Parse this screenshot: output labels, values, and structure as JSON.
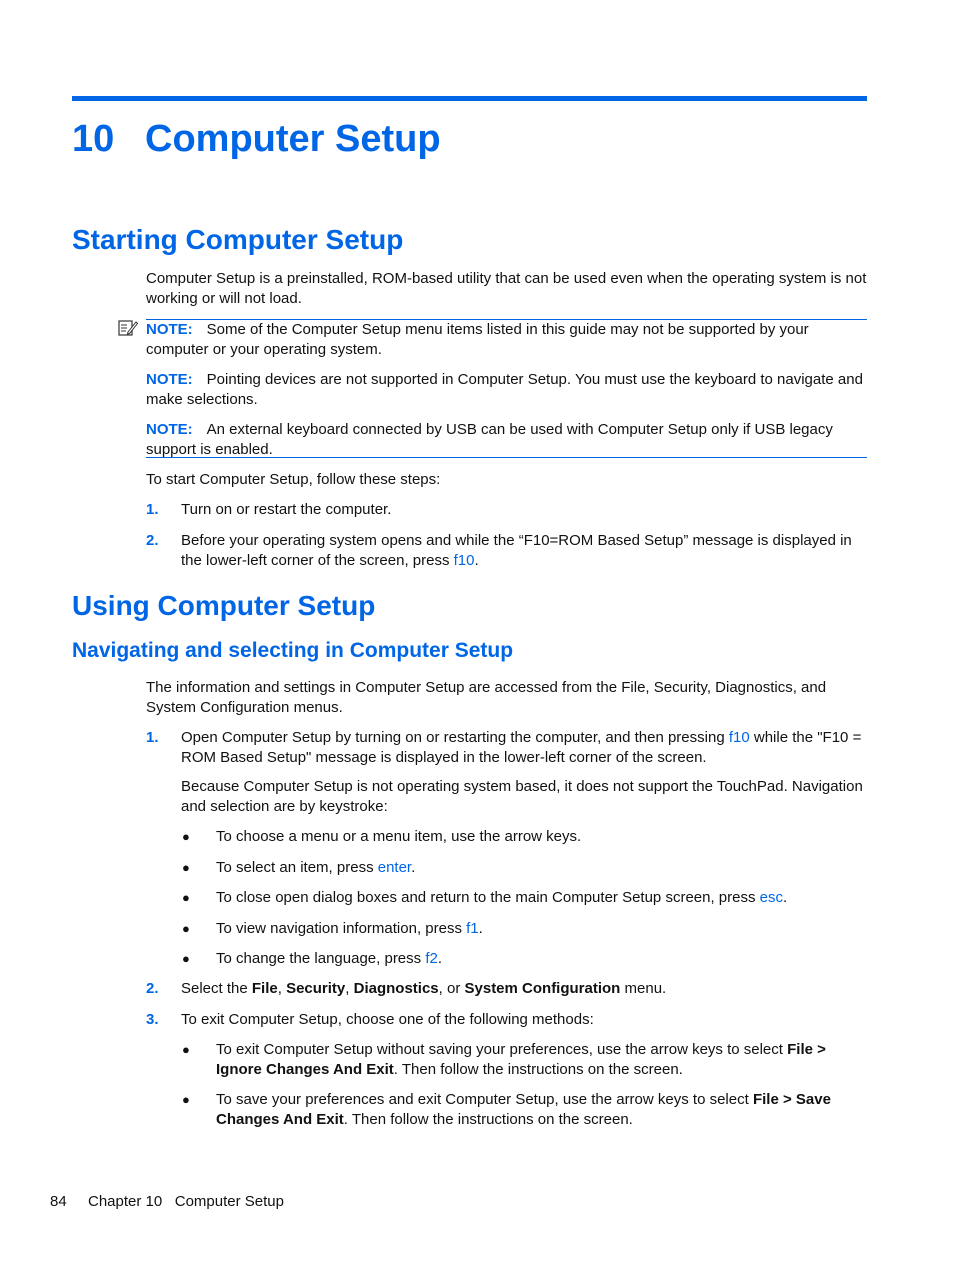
{
  "chapter": {
    "number": "10",
    "title": "Computer Setup"
  },
  "section1": {
    "title": "Starting Computer Setup",
    "intro": "Computer Setup is a preinstalled, ROM-based utility that can be used even when the operating system is not working or will not load.",
    "notes": [
      {
        "label": "NOTE:",
        "text": "Some of the Computer Setup menu items listed in this guide may not be supported by your computer or your operating system."
      },
      {
        "label": "NOTE:",
        "text": "Pointing devices are not supported in Computer Setup. You must use the keyboard to navigate and make selections."
      },
      {
        "label": "NOTE:",
        "text": "An external keyboard connected by USB can be used with Computer Setup only if USB legacy support is enabled."
      }
    ],
    "steps_intro": "To start Computer Setup, follow these steps:",
    "steps": [
      {
        "num": "1.",
        "text": "Turn on or restart the computer."
      },
      {
        "num": "2.",
        "text_before": "Before your operating system opens and while the “F10=ROM Based Setup” message is displayed in the lower-left corner of the screen, press ",
        "key": "f10",
        "text_after": "."
      }
    ]
  },
  "section2": {
    "title": "Using Computer Setup",
    "subsection": {
      "title": "Navigating and selecting in Computer Setup",
      "intro": "The information and settings in Computer Setup are accessed from the File, Security, Diagnostics, and System Configuration menus.",
      "step1": {
        "num": "1.",
        "text_before": "Open Computer Setup by turning on or restarting the computer, and then pressing ",
        "key": "f10",
        "text_after": " while the \"F10 = ROM Based Setup\" message is displayed in the lower-left corner of the screen.",
        "para2": "Because Computer Setup is not operating system based, it does not support the TouchPad. Navigation and selection are by keystroke:",
        "bullets": [
          {
            "text_before": "To choose a menu or a menu item, use the arrow keys.",
            "key": "",
            "text_after": ""
          },
          {
            "text_before": "To select an item, press ",
            "key": "enter",
            "text_after": "."
          },
          {
            "text_before": "To close open dialog boxes and return to the main Computer Setup screen, press ",
            "key": "esc",
            "text_after": "."
          },
          {
            "text_before": "To view navigation information, press ",
            "key": "f1",
            "text_after": "."
          },
          {
            "text_before": "To change the language, press ",
            "key": "f2",
            "text_after": "."
          }
        ]
      },
      "step2": {
        "num": "2.",
        "t1": "Select the ",
        "b1": "File",
        "t2": ", ",
        "b2": "Security",
        "t3": ", ",
        "b3": "Diagnostics",
        "t4": ", or ",
        "b4": "System Configuration",
        "t5": " menu."
      },
      "step3": {
        "num": "3.",
        "text": "To exit Computer Setup, choose one of the following methods:",
        "bullets": [
          {
            "before": "To exit Computer Setup without saving your preferences, use the arrow keys to select ",
            "bold": "File > Ignore Changes And Exit",
            "after": ". Then follow the instructions on the screen."
          },
          {
            "before": "To save your preferences and exit Computer Setup, use the arrow keys to select ",
            "bold": "File > Save Changes And Exit",
            "after": ". Then follow the instructions on the screen."
          }
        ]
      }
    }
  },
  "footer": {
    "page_number": "84",
    "chapter_label": "Chapter 10",
    "chapter_title": "Computer Setup"
  },
  "icons": {
    "note": "note-pencil-icon",
    "bullet": "●"
  }
}
